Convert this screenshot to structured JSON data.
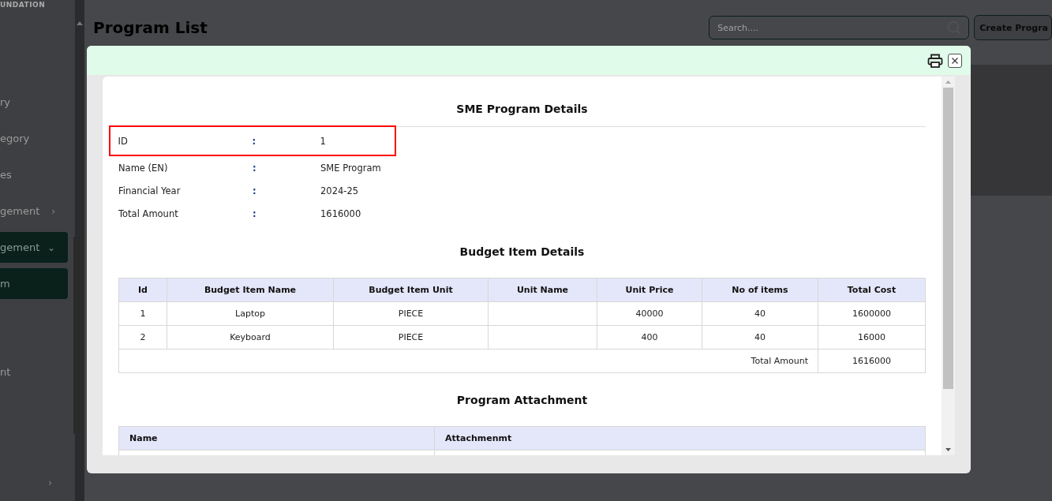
{
  "sidebar": {
    "brand": "UNDATION",
    "items": [
      {
        "label": "ry",
        "selected": false
      },
      {
        "label": "egory",
        "selected": false
      },
      {
        "label": "es",
        "selected": false
      },
      {
        "label": "gement",
        "selected": false,
        "chevron": "›"
      },
      {
        "label": "gement",
        "selected": true,
        "chevron": "⌄"
      },
      {
        "label": "m",
        "selected": true
      },
      {
        "label": "nt",
        "selected": false
      },
      {
        "selected": false,
        "chevron": "›"
      }
    ]
  },
  "page": {
    "title": "Program List",
    "search": {
      "placeholder": "Search...."
    },
    "create_button": "Create Progra"
  },
  "modal": {
    "title": "SME Program Details",
    "fields": [
      {
        "label": "ID",
        "value": "1",
        "highlighted": true
      },
      {
        "label": "Name (EN)",
        "value": "SME Program",
        "highlighted": false
      },
      {
        "label": "Financial Year",
        "value": "2024-25",
        "highlighted": false
      },
      {
        "label": "Total Amount",
        "value": "1616000",
        "highlighted": false
      }
    ],
    "separator": ":",
    "budget": {
      "title": "Budget Item Details",
      "columns": [
        "Id",
        "Budget Item Name",
        "Budget Item Unit",
        "Unit Name",
        "Unit Price",
        "No of items",
        "Total Cost"
      ],
      "rows": [
        [
          "1",
          "Laptop",
          "PIECE",
          "",
          "40000",
          "40",
          "1600000"
        ],
        [
          "2",
          "Keyboard",
          "PIECE",
          "",
          "400",
          "40",
          "16000"
        ]
      ],
      "total_label": "Total Amount",
      "total_value": "1616000"
    },
    "attachment": {
      "title": "Program Attachment",
      "columns": [
        "Name",
        "Attachmenmt"
      ]
    }
  }
}
